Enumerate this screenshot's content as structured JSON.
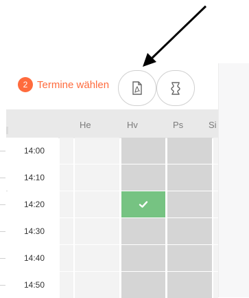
{
  "step": {
    "number": "2",
    "title": "Termine wählen"
  },
  "toolbar": {
    "pdf_icon": "pdf-file-icon",
    "alt_icon": "document-scroll-icon"
  },
  "days": [
    "He",
    "Hv",
    "Ps",
    "Si"
  ],
  "times": [
    "14:00",
    "14:10",
    "14:20",
    "14:30",
    "14:40",
    "14:50"
  ],
  "selected_slot": {
    "time": "14:20",
    "day": "Hv"
  },
  "colors": {
    "accent": "#ff6b3d",
    "selected": "#76c382",
    "available": "#d5d5d5"
  }
}
